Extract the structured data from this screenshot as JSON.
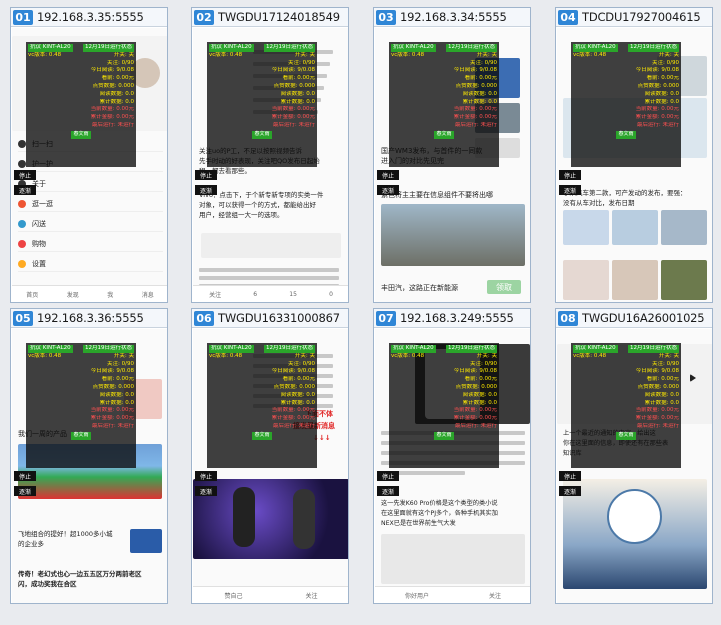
{
  "overlay": {
    "rows": [
      {
        "l": "抗议 KINT-AL20",
        "r": "12月19日运行状态"
      },
      {
        "l": "vc版本: 0.48",
        "r": "开关: 关"
      },
      {
        "l": "",
        "r": "关注: 0/90"
      },
      {
        "l": "",
        "r": "今日阅读: 9/0.08"
      },
      {
        "l": "",
        "r": "看前: 0.00元"
      },
      {
        "l": "",
        "r": "点赞数据: 0.000"
      },
      {
        "l": "",
        "r": "阅读数据: 0.0"
      },
      {
        "l": "",
        "r": "累计数据: 0.0"
      },
      {
        "l": "",
        "r": ""
      },
      {
        "l": "",
        "r": "当前数量: 0.00元"
      },
      {
        "l": "",
        "r": "累计金额: 0.00元"
      },
      {
        "l": "",
        "r": "最后运行: 未运行"
      }
    ],
    "status_btn": "春文雨",
    "stop_label": "停止",
    "browse_label": "逐渐"
  },
  "tiles": [
    {
      "num": "01",
      "name": "192.168.3.35:5555"
    },
    {
      "num": "02",
      "name": "TWGDU17124018549"
    },
    {
      "num": "03",
      "name": "192.168.3.34:5555"
    },
    {
      "num": "04",
      "name": "TDCDU17927004615"
    },
    {
      "num": "05",
      "name": "192.168.3.36:5555"
    },
    {
      "num": "06",
      "name": "TWGDU16331000867"
    },
    {
      "num": "07",
      "name": "192.168.3.249:5555"
    },
    {
      "num": "08",
      "name": "TWGDU16A26001025"
    }
  ],
  "tile1": {
    "items": [
      "扫一扫",
      "护一护",
      "关于",
      "逛一逛",
      "闪送",
      "购物",
      "设置"
    ],
    "tabs": [
      "首页",
      "发现",
      "我",
      "消息"
    ]
  },
  "tile2": {
    "lines": [
      "关注uo的P工，不足以按照视频告诉",
      "先手时动的好表现，关注吧QO发布日起始",
      "程，都去看那些。",
      "Vivo：点击下，于个新专新专项的实类一件",
      "对象，可以获得一个的方式，都能给出好",
      "用户，经营组一大一的选项。"
    ],
    "footer": [
      "关注",
      "6",
      "15",
      "0"
    ]
  },
  "tile3": {
    "news1": "国产WM3发布，与首件的一同款",
    "news1b": "进入门的对比先见完",
    "news2": "紫色将主主要在信息组件不要将出哪",
    "news3": "丰田汽，这路正在新能源",
    "btn": "领取"
  },
  "tile4": {
    "headline": "小米汽车第二款，可产发动的发布，要强：",
    "headline2": "没有从车对比，发布日期"
  },
  "tile5": {
    "t1": "我们一周的产品",
    "t2": "飞地组合的提好！超1000多小城",
    "t3": "的企业多",
    "t4": "传奇！老幻式也心一边五五区万分两前老区",
    "t5": "闪，成功奖我在合区"
  },
  "tile6": {
    "red": "下面不体",
    "red2": "接发最新消息",
    "arrows": "↓↓↓",
    "footer": [
      "赞自己",
      "关注"
    ]
  },
  "tile7": {
    "t1": "这一先发K60 Pro价格是这个类型的类小说",
    "t2": "在这里面就有这个PJ多个，各种手机其实加",
    "t3": "NEX已是在世界前生气大发",
    "footer": [
      "你好用户",
      "关注"
    ]
  },
  "tile8": {
    "t1": "上一个最近的通知的内容，给出这 ",
    "t2": "你在这里面的信息，即使还有在那些表",
    "t3": "知识库"
  }
}
